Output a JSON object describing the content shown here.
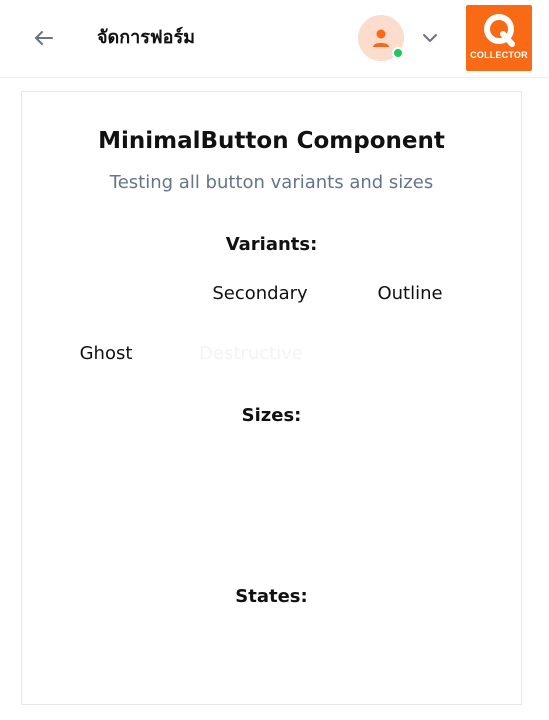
{
  "header": {
    "title": "จัดการฟอร์ม",
    "logo_text": "COLLECTOR",
    "logo_letter": "Q"
  },
  "colors": {
    "brand": "#f96a16",
    "avatar_bg": "#fcdccd",
    "online": "#22c55e",
    "subtitle": "#64748b"
  },
  "icons": {
    "back": "arrow-left-icon",
    "avatar": "user-icon",
    "dropdown": "chevron-down-icon"
  },
  "card": {
    "title": "MinimalButton Component",
    "subtitle": "Testing all button variants and sizes",
    "variants_label": "Variants:",
    "sizes_label": "Sizes:",
    "states_label": "States:"
  },
  "variants": {
    "secondary": "Secondary",
    "outline": "Outline",
    "ghost": "Ghost",
    "destructive": "Destructive"
  }
}
